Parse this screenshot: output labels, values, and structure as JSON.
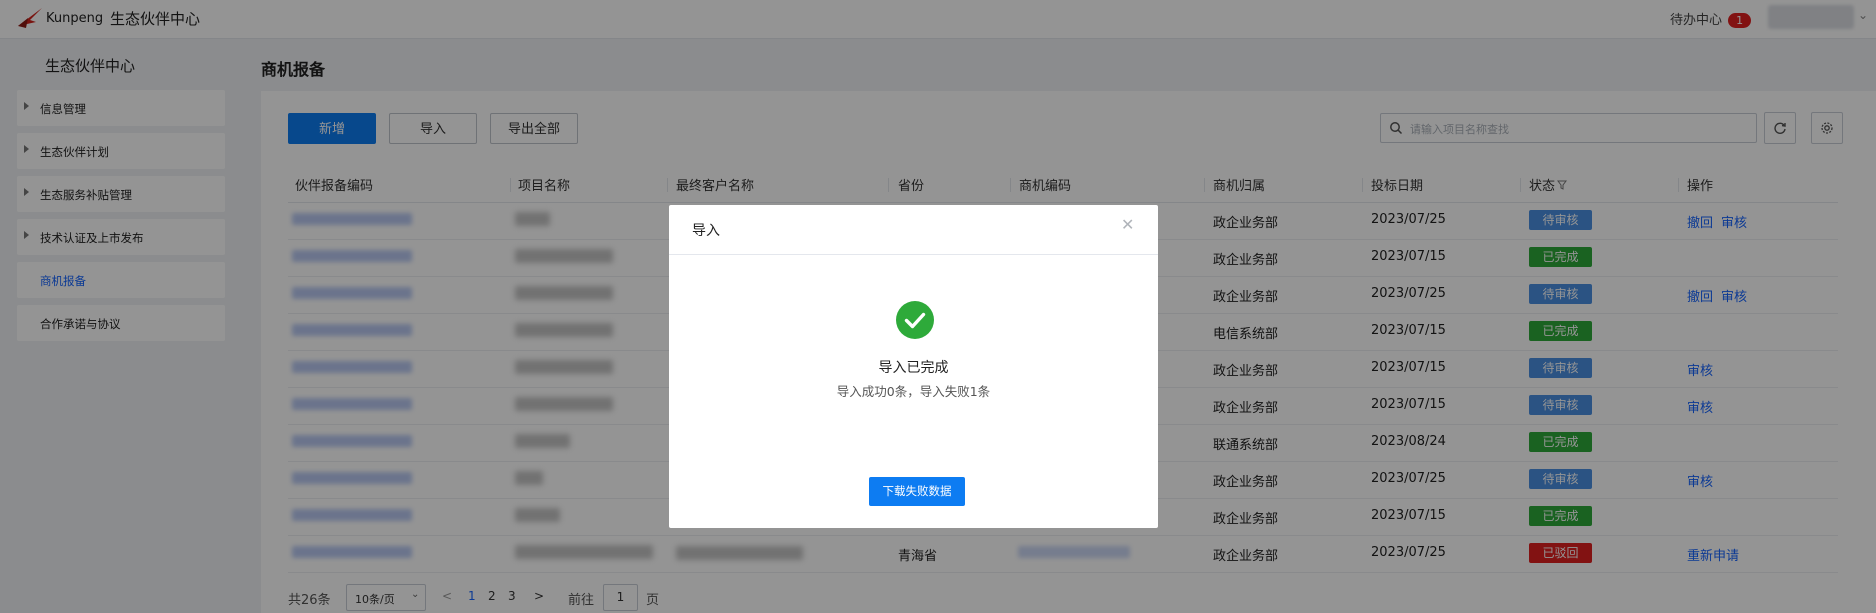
{
  "header": {
    "brand": "Kunpeng",
    "center_title": "生态伙伴中心",
    "todo_label": "待办中心",
    "todo_count": "1"
  },
  "sidebar": {
    "title": "生态伙伴中心",
    "items": [
      {
        "label": "信息管理"
      },
      {
        "label": "生态伙伴计划"
      },
      {
        "label": "生态服务补贴管理"
      },
      {
        "label": "技术认证及上市发布"
      },
      {
        "label": "商机报备"
      },
      {
        "label": "合作承诺与协议"
      }
    ]
  },
  "main": {
    "page_title": "商机报备",
    "toolbar": {
      "new_label": "新增",
      "import_label": "导入",
      "export_label": "导出全部"
    },
    "search": {
      "placeholder": "请输入项目名称查找",
      "value": ""
    },
    "table": {
      "columns": [
        "伙伴报备编码",
        "项目名称",
        "最终客户名称",
        "省份",
        "商机编码",
        "商机归属",
        "投标日期",
        "状态",
        "操作"
      ],
      "rows": [
        {
          "province": "",
          "department": "政企业务部",
          "date": "2023/07/25",
          "status": "待审核",
          "status_type": "pending",
          "ops": [
            "撤回",
            "审核"
          ]
        },
        {
          "province": "",
          "department": "政企业务部",
          "date": "2023/07/15",
          "status": "已完成",
          "status_type": "done",
          "ops": []
        },
        {
          "province": "",
          "department": "政企业务部",
          "date": "2023/07/25",
          "status": "待审核",
          "status_type": "pending",
          "ops": [
            "撤回",
            "审核"
          ]
        },
        {
          "province": "",
          "department": "电信系统部",
          "date": "2023/07/15",
          "status": "已完成",
          "status_type": "done",
          "ops": []
        },
        {
          "province": "",
          "department": "政企业务部",
          "date": "2023/07/15",
          "status": "待审核",
          "status_type": "pending",
          "ops": [
            "审核"
          ]
        },
        {
          "province": "",
          "department": "政企业务部",
          "date": "2023/07/15",
          "status": "待审核",
          "status_type": "pending",
          "ops": [
            "审核"
          ]
        },
        {
          "province": "",
          "department": "联通系统部",
          "date": "2023/08/24",
          "status": "已完成",
          "status_type": "done",
          "ops": []
        },
        {
          "province": "",
          "department": "政企业务部",
          "date": "2023/07/25",
          "status": "待审核",
          "status_type": "pending",
          "ops": [
            "审核"
          ]
        },
        {
          "province": "",
          "department": "政企业务部",
          "date": "2023/07/15",
          "status": "已完成",
          "status_type": "done",
          "ops": []
        },
        {
          "province": "青海省",
          "department": "政企业务部",
          "date": "2023/07/25",
          "status": "已驳回",
          "status_type": "rejected",
          "ops": [
            "重新申请"
          ]
        }
      ]
    },
    "pagination": {
      "total": "共26条",
      "page_size": "10条/页",
      "pages": [
        "1",
        "2",
        "3"
      ],
      "current_page": "1",
      "goto_label": "前往",
      "page_unit": "页"
    }
  },
  "modal": {
    "title": "导入",
    "message": "导入已完成",
    "detail": "导入成功0条，导入失败1条",
    "button_label": "下载失败数据"
  },
  "colors": {
    "primary": "#0d7cf2",
    "link": "#1664ff",
    "status_pending": "#4a90e2",
    "status_done": "#2eaa3a",
    "status_rejected": "#e02020",
    "success_icon": "#2eaa3a"
  }
}
